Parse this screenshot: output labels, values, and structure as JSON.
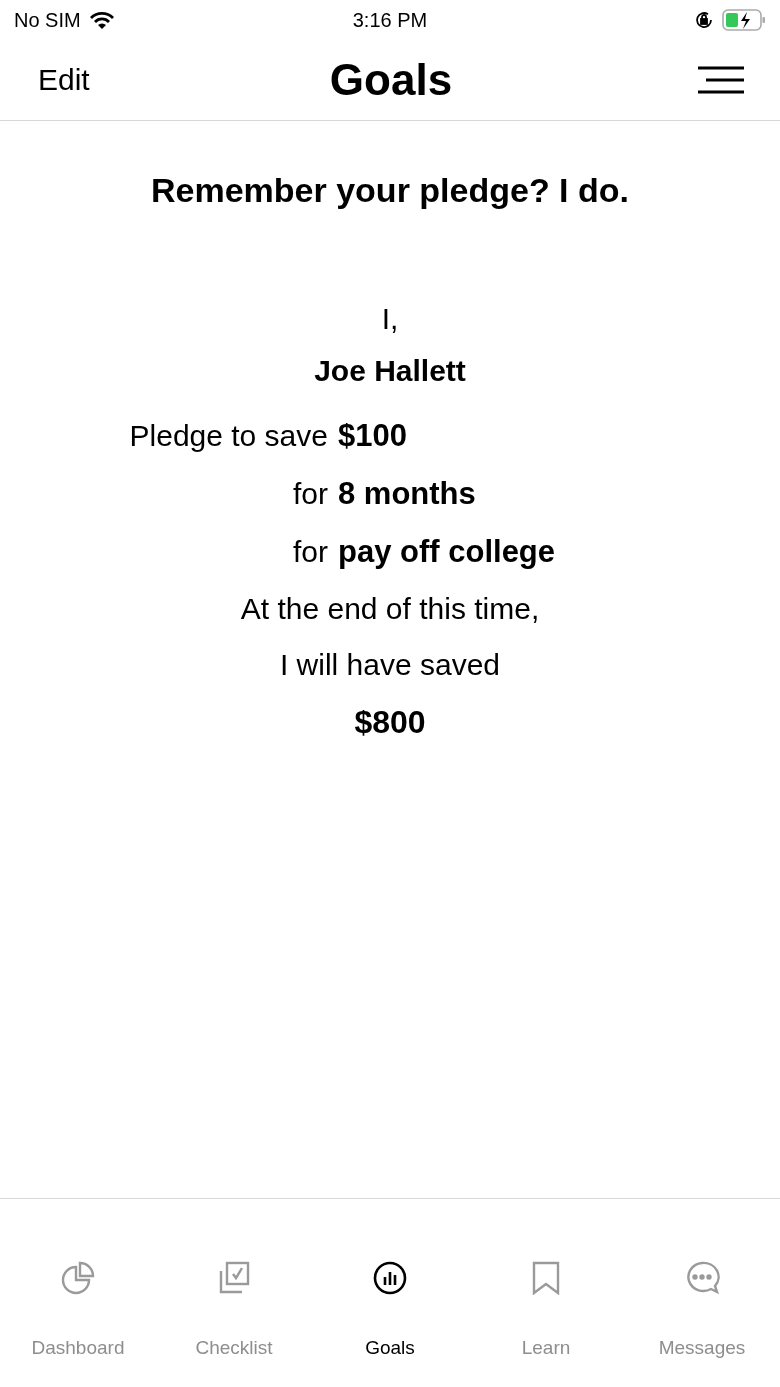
{
  "status_bar": {
    "carrier": "No SIM",
    "time": "3:16 PM"
  },
  "nav_bar": {
    "left_button": "Edit",
    "title": "Goals"
  },
  "heading": "Remember your pledge? I do.",
  "pledge": {
    "intro": "I,",
    "name": "Joe Hallett",
    "rows": [
      {
        "label": "Pledge to save",
        "value": "$100"
      },
      {
        "label": "for",
        "value": "8 months"
      },
      {
        "label": "for",
        "value": "pay off college"
      }
    ],
    "closing": [
      "At the end of this time,",
      "I will have saved"
    ],
    "total": "$800"
  },
  "tabs": [
    {
      "label": "Dashboard",
      "kind": "pie",
      "selected": false
    },
    {
      "label": "Checklist",
      "kind": "checklist",
      "selected": false
    },
    {
      "label": "Goals",
      "kind": "chart",
      "selected": true
    },
    {
      "label": "Learn",
      "kind": "bookmark",
      "selected": false
    },
    {
      "label": "Messages",
      "kind": "chat",
      "selected": false
    }
  ]
}
